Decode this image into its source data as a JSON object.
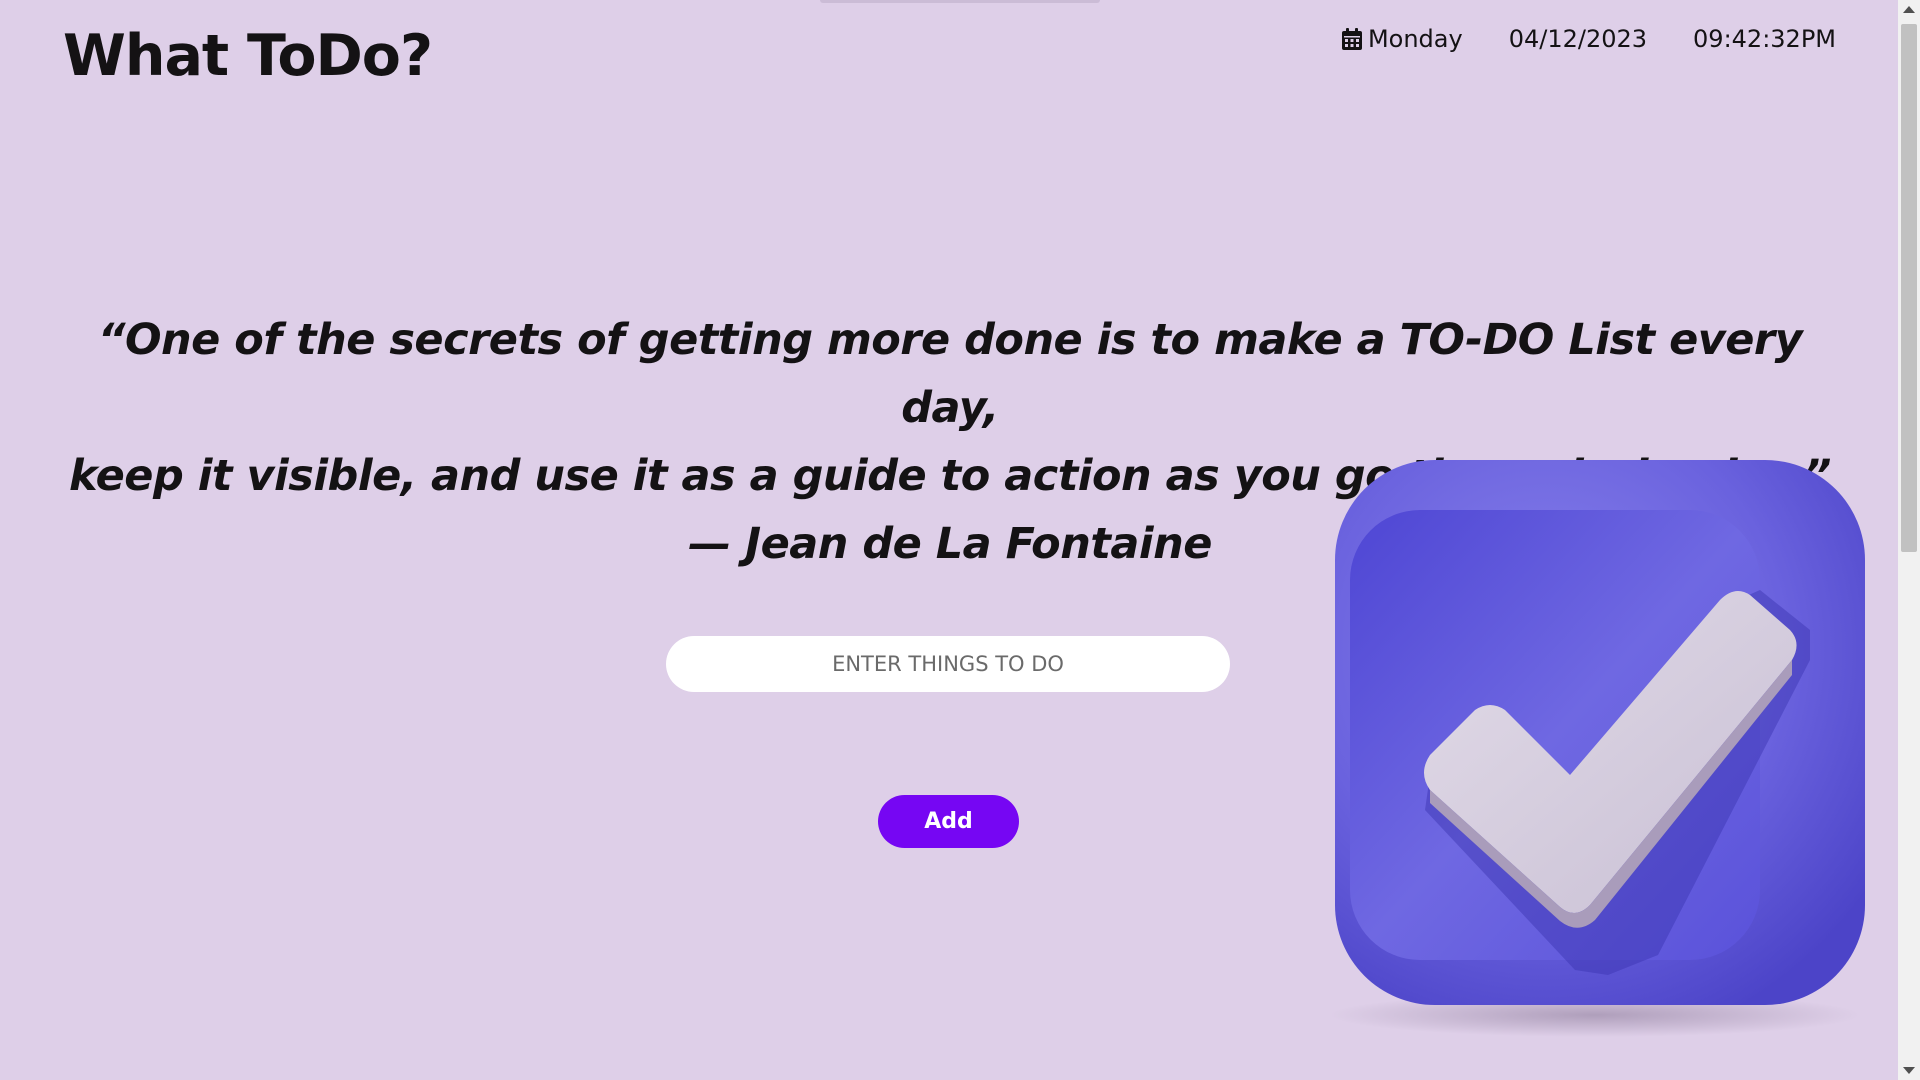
{
  "header": {
    "brand": "What ToDo?",
    "day": "Monday",
    "date": "04/12/2023",
    "time": "09:42:32PM",
    "day_icon": "calendar-icon"
  },
  "quote": {
    "line1": "“One of the secrets of getting more done is to make a TO-DO List every day,",
    "line2": "keep it visible, and use it as a guide to action as you go through the day.”",
    "author": "— Jean de La Fontaine"
  },
  "todo_form": {
    "placeholder": "ENTER THINGS TO DO",
    "value": "",
    "add_label": "Add"
  },
  "illustration": {
    "icon": "checkmark-box-icon"
  },
  "colors": {
    "background": "#decfe8",
    "text": "#141214",
    "accent": "#7606f3",
    "input_bg": "#ffffff",
    "illustration_box": "#6b64e0",
    "illustration_check": "#d8cfe0"
  }
}
